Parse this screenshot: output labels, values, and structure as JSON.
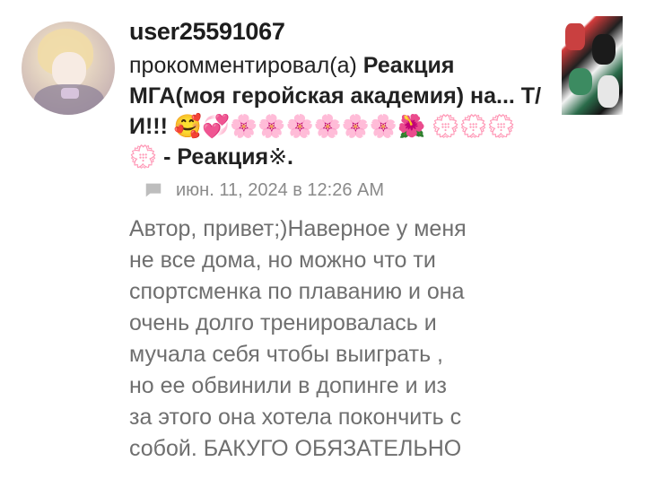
{
  "comment": {
    "username": "user25591067",
    "action": "прокомментировал(а)",
    "post_title": "Реакция МГА(моя геройская академия) на... Т/И!!!",
    "title_emojis": {
      "face": "🥰",
      "heart": "💞",
      "blossoms": "🌸🌸🌸🌸🌸🌸",
      "hibiscus": "🌺",
      "outline_flowers": "💮💮💮💮"
    },
    "title_suffix": " - Реакция",
    "title_end_symbol": "※",
    "title_end_period": ".",
    "date": "июн. 11, 2024 в 12:26 AM",
    "text": "Автор, привет;)Наверное у меня\nне все дома, но можно что ти\nспортсменка по плаванию и она\nочень долго тренировалась и\nмучала себя чтобы выиграть ,\nно ее обвинили в допинге и из\nза этого она хотела покончить с\nсобой.  БАКУГО ОБЯЗАТЕЛЬНО"
  },
  "icons": {
    "comment": "chat-bubble-icon"
  },
  "colors": {
    "username": "#1d1d1d",
    "date": "#8a8a8a",
    "body_text": "#6f6f6f",
    "icon": "#bdbdbd"
  }
}
